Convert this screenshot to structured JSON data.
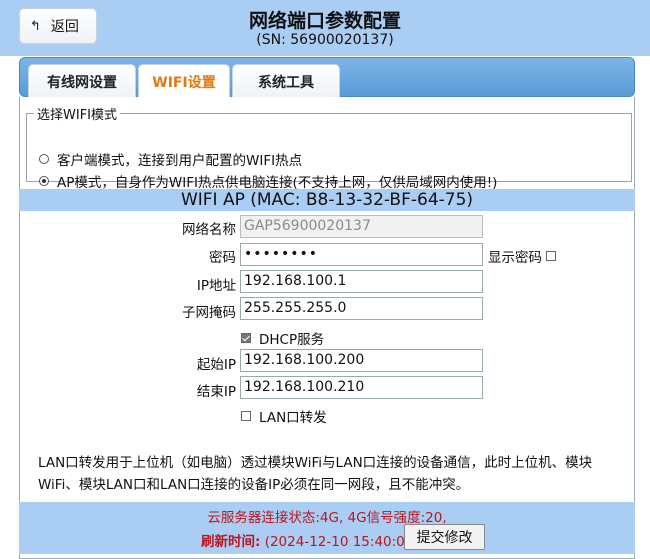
{
  "header": {
    "back_label": "返回",
    "title": "网络端口参数配置",
    "sn": "(SN: 56900020137)"
  },
  "tabs": [
    {
      "label": "有线网设置",
      "active": false
    },
    {
      "label": "WIFI设置",
      "active": true
    },
    {
      "label": "系统工具",
      "active": false
    }
  ],
  "mode": {
    "legend": "选择WIFI模式",
    "options": [
      {
        "label": "客户端模式，连接到用户配置的WIFI热点",
        "selected": false
      },
      {
        "label": "AP模式，自身作为WIFI热点供电脑连接(不支持上网，仅供局域网内使用!)",
        "selected": true
      }
    ]
  },
  "ap": {
    "header": "WIFI AP (MAC: B8-13-32-BF-64-75)",
    "ssid_label": "网络名称",
    "ssid_value": "GAP56900020137",
    "password_label": "密码",
    "password_value": "••••••••",
    "show_password_label": "显示密码",
    "ip_label": "IP地址",
    "ip_value": "192.168.100.1",
    "mask_label": "子网掩码",
    "mask_value": "255.255.255.0",
    "dhcp_label": "DHCP服务",
    "dhcp_checked": true,
    "start_ip_label": "起始IP",
    "start_ip_value": "192.168.100.200",
    "end_ip_label": "结束IP",
    "end_ip_value": "192.168.100.210",
    "lan_forward_label": "LAN口转发",
    "lan_forward_checked": false
  },
  "note": "LAN口转发用于上位机（如电脑）透过模块WiFi与LAN口连接的设备通信，此时上位机、模块WiFi、模块LAN口和LAN口连接的设备IP必须在同一网段，且不能冲突。",
  "footer": {
    "status": "云服务器连接状态:4G, 4G信号强度:20,",
    "refresh_label": "刷新时间:",
    "refresh_time": " (2024-12-10 15:40:07)",
    "submit_label": "提交修改"
  },
  "colors": {
    "header_bg": "#a9cdf3",
    "active_tab": "#e07a10",
    "status_red": "#c0141c"
  }
}
